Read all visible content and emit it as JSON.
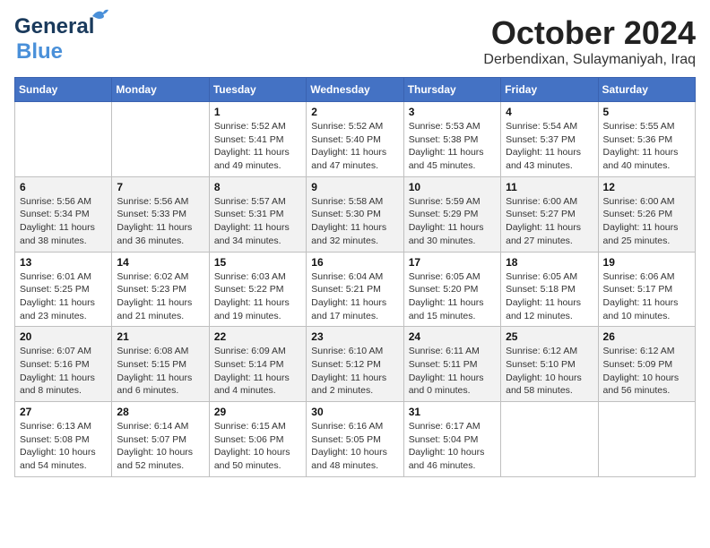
{
  "logo": {
    "line1": "General",
    "line2": "Blue"
  },
  "title": "October 2024",
  "location": "Derbendixan, Sulaymaniyah, Iraq",
  "days_header": [
    "Sunday",
    "Monday",
    "Tuesday",
    "Wednesday",
    "Thursday",
    "Friday",
    "Saturday"
  ],
  "weeks": [
    [
      {
        "day": "",
        "info": ""
      },
      {
        "day": "",
        "info": ""
      },
      {
        "day": "1",
        "info": "Sunrise: 5:52 AM\nSunset: 5:41 PM\nDaylight: 11 hours and 49 minutes."
      },
      {
        "day": "2",
        "info": "Sunrise: 5:52 AM\nSunset: 5:40 PM\nDaylight: 11 hours and 47 minutes."
      },
      {
        "day": "3",
        "info": "Sunrise: 5:53 AM\nSunset: 5:38 PM\nDaylight: 11 hours and 45 minutes."
      },
      {
        "day": "4",
        "info": "Sunrise: 5:54 AM\nSunset: 5:37 PM\nDaylight: 11 hours and 43 minutes."
      },
      {
        "day": "5",
        "info": "Sunrise: 5:55 AM\nSunset: 5:36 PM\nDaylight: 11 hours and 40 minutes."
      }
    ],
    [
      {
        "day": "6",
        "info": "Sunrise: 5:56 AM\nSunset: 5:34 PM\nDaylight: 11 hours and 38 minutes."
      },
      {
        "day": "7",
        "info": "Sunrise: 5:56 AM\nSunset: 5:33 PM\nDaylight: 11 hours and 36 minutes."
      },
      {
        "day": "8",
        "info": "Sunrise: 5:57 AM\nSunset: 5:31 PM\nDaylight: 11 hours and 34 minutes."
      },
      {
        "day": "9",
        "info": "Sunrise: 5:58 AM\nSunset: 5:30 PM\nDaylight: 11 hours and 32 minutes."
      },
      {
        "day": "10",
        "info": "Sunrise: 5:59 AM\nSunset: 5:29 PM\nDaylight: 11 hours and 30 minutes."
      },
      {
        "day": "11",
        "info": "Sunrise: 6:00 AM\nSunset: 5:27 PM\nDaylight: 11 hours and 27 minutes."
      },
      {
        "day": "12",
        "info": "Sunrise: 6:00 AM\nSunset: 5:26 PM\nDaylight: 11 hours and 25 minutes."
      }
    ],
    [
      {
        "day": "13",
        "info": "Sunrise: 6:01 AM\nSunset: 5:25 PM\nDaylight: 11 hours and 23 minutes."
      },
      {
        "day": "14",
        "info": "Sunrise: 6:02 AM\nSunset: 5:23 PM\nDaylight: 11 hours and 21 minutes."
      },
      {
        "day": "15",
        "info": "Sunrise: 6:03 AM\nSunset: 5:22 PM\nDaylight: 11 hours and 19 minutes."
      },
      {
        "day": "16",
        "info": "Sunrise: 6:04 AM\nSunset: 5:21 PM\nDaylight: 11 hours and 17 minutes."
      },
      {
        "day": "17",
        "info": "Sunrise: 6:05 AM\nSunset: 5:20 PM\nDaylight: 11 hours and 15 minutes."
      },
      {
        "day": "18",
        "info": "Sunrise: 6:05 AM\nSunset: 5:18 PM\nDaylight: 11 hours and 12 minutes."
      },
      {
        "day": "19",
        "info": "Sunrise: 6:06 AM\nSunset: 5:17 PM\nDaylight: 11 hours and 10 minutes."
      }
    ],
    [
      {
        "day": "20",
        "info": "Sunrise: 6:07 AM\nSunset: 5:16 PM\nDaylight: 11 hours and 8 minutes."
      },
      {
        "day": "21",
        "info": "Sunrise: 6:08 AM\nSunset: 5:15 PM\nDaylight: 11 hours and 6 minutes."
      },
      {
        "day": "22",
        "info": "Sunrise: 6:09 AM\nSunset: 5:14 PM\nDaylight: 11 hours and 4 minutes."
      },
      {
        "day": "23",
        "info": "Sunrise: 6:10 AM\nSunset: 5:12 PM\nDaylight: 11 hours and 2 minutes."
      },
      {
        "day": "24",
        "info": "Sunrise: 6:11 AM\nSunset: 5:11 PM\nDaylight: 11 hours and 0 minutes."
      },
      {
        "day": "25",
        "info": "Sunrise: 6:12 AM\nSunset: 5:10 PM\nDaylight: 10 hours and 58 minutes."
      },
      {
        "day": "26",
        "info": "Sunrise: 6:12 AM\nSunset: 5:09 PM\nDaylight: 10 hours and 56 minutes."
      }
    ],
    [
      {
        "day": "27",
        "info": "Sunrise: 6:13 AM\nSunset: 5:08 PM\nDaylight: 10 hours and 54 minutes."
      },
      {
        "day": "28",
        "info": "Sunrise: 6:14 AM\nSunset: 5:07 PM\nDaylight: 10 hours and 52 minutes."
      },
      {
        "day": "29",
        "info": "Sunrise: 6:15 AM\nSunset: 5:06 PM\nDaylight: 10 hours and 50 minutes."
      },
      {
        "day": "30",
        "info": "Sunrise: 6:16 AM\nSunset: 5:05 PM\nDaylight: 10 hours and 48 minutes."
      },
      {
        "day": "31",
        "info": "Sunrise: 6:17 AM\nSunset: 5:04 PM\nDaylight: 10 hours and 46 minutes."
      },
      {
        "day": "",
        "info": ""
      },
      {
        "day": "",
        "info": ""
      }
    ]
  ]
}
